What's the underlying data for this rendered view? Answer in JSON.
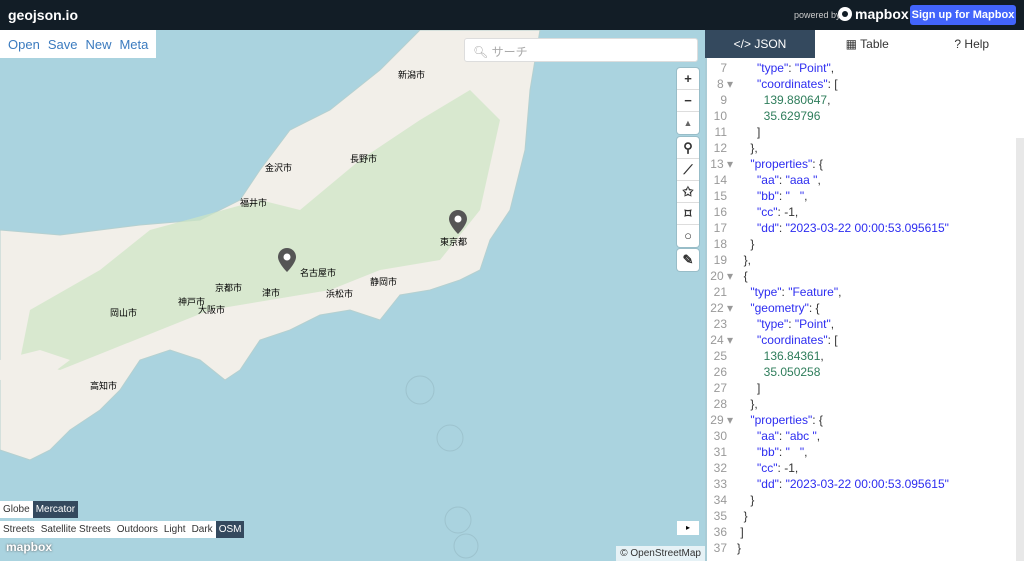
{
  "header": {
    "logo": "geojson.io",
    "powered_by": "powered by",
    "mapbox": "mapbox",
    "signup": "Sign up for Mapbox"
  },
  "file_menu": [
    "Open",
    "Save",
    "New",
    "Meta"
  ],
  "search": {
    "placeholder": "サーチ"
  },
  "map_controls": {
    "zoom_in": "+",
    "zoom_out": "−",
    "compass": "▲"
  },
  "draw_tools": [
    "marker-icon",
    "line-icon",
    "polygon-icon",
    "rectangle-icon",
    "circle-icon"
  ],
  "projection": {
    "options": [
      "Globe",
      "Mercator"
    ],
    "selected": "Mercator"
  },
  "styles": {
    "options": [
      "Streets",
      "Satellite Streets",
      "Outdoors",
      "Light",
      "Dark",
      "OSM"
    ],
    "selected": "OSM"
  },
  "map_labels": [
    "東京都",
    "名古屋市",
    "大阪市",
    "京都市",
    "浜松市",
    "静岡市",
    "長野市",
    "新潟市",
    "金沢市",
    "福井市",
    "津市",
    "神戸市",
    "岡山市",
    "高知市"
  ],
  "watermark": "mapbox",
  "attribution": "© OpenStreetMap",
  "collapse": "▸",
  "tabs": [
    {
      "label": "JSON",
      "icon": "</>"
    },
    {
      "label": "Table",
      "icon": "▦"
    },
    {
      "label": "Help",
      "icon": "?"
    }
  ],
  "editor": {
    "lines": [
      {
        "n": "7",
        "s": [
          [
            "      ",
            "p"
          ],
          [
            "\"type\"",
            "k"
          ],
          [
            ": ",
            "p"
          ],
          [
            "\"Point\"",
            "k"
          ],
          [
            ",",
            "p"
          ]
        ]
      },
      {
        "n": "8",
        "f": 1,
        "s": [
          [
            "      ",
            "p"
          ],
          [
            "\"coordinates\"",
            "k"
          ],
          [
            ": [",
            "p"
          ]
        ]
      },
      {
        "n": "9",
        "s": [
          [
            "        ",
            "p"
          ],
          [
            "139.880647",
            "n"
          ],
          [
            ",",
            "p"
          ]
        ]
      },
      {
        "n": "10",
        "s": [
          [
            "        ",
            "p"
          ],
          [
            "35.629796",
            "n"
          ]
        ]
      },
      {
        "n": "11",
        "s": [
          [
            "      ]",
            "p"
          ]
        ]
      },
      {
        "n": "12",
        "s": [
          [
            "    },",
            "p"
          ]
        ]
      },
      {
        "n": "13",
        "f": 1,
        "s": [
          [
            "    ",
            "p"
          ],
          [
            "\"properties\"",
            "k"
          ],
          [
            ": {",
            "p"
          ]
        ]
      },
      {
        "n": "14",
        "s": [
          [
            "      ",
            "p"
          ],
          [
            "\"aa\"",
            "k"
          ],
          [
            ": ",
            "p"
          ],
          [
            "\"aaa \"",
            "k"
          ],
          [
            ",",
            "p"
          ]
        ]
      },
      {
        "n": "15",
        "s": [
          [
            "      ",
            "p"
          ],
          [
            "\"bb\"",
            "k"
          ],
          [
            ": ",
            "p"
          ],
          [
            "\"   \"",
            "k"
          ],
          [
            ",",
            "p"
          ]
        ]
      },
      {
        "n": "16",
        "s": [
          [
            "      ",
            "p"
          ],
          [
            "\"cc\"",
            "k"
          ],
          [
            ": -1,",
            "p"
          ]
        ]
      },
      {
        "n": "17",
        "s": [
          [
            "      ",
            "p"
          ],
          [
            "\"dd\"",
            "k"
          ],
          [
            ": ",
            "p"
          ],
          [
            "\"2023-03-22 00:00:53.095615\"",
            "k"
          ]
        ]
      },
      {
        "n": "18",
        "s": [
          [
            "    }",
            "p"
          ]
        ]
      },
      {
        "n": "19",
        "s": [
          [
            "  },",
            "p"
          ]
        ]
      },
      {
        "n": "20",
        "f": 1,
        "s": [
          [
            "  {",
            "p"
          ]
        ]
      },
      {
        "n": "21",
        "s": [
          [
            "    ",
            "p"
          ],
          [
            "\"type\"",
            "k"
          ],
          [
            ": ",
            "p"
          ],
          [
            "\"Feature\"",
            "k"
          ],
          [
            ",",
            "p"
          ]
        ]
      },
      {
        "n": "22",
        "f": 1,
        "s": [
          [
            "    ",
            "p"
          ],
          [
            "\"geometry\"",
            "k"
          ],
          [
            ": {",
            "p"
          ]
        ]
      },
      {
        "n": "23",
        "s": [
          [
            "      ",
            "p"
          ],
          [
            "\"type\"",
            "k"
          ],
          [
            ": ",
            "p"
          ],
          [
            "\"Point\"",
            "k"
          ],
          [
            ",",
            "p"
          ]
        ]
      },
      {
        "n": "24",
        "f": 1,
        "s": [
          [
            "      ",
            "p"
          ],
          [
            "\"coordinates\"",
            "k"
          ],
          [
            ": [",
            "p"
          ]
        ]
      },
      {
        "n": "25",
        "s": [
          [
            "        ",
            "p"
          ],
          [
            "136.84361",
            "n"
          ],
          [
            ",",
            "p"
          ]
        ]
      },
      {
        "n": "26",
        "s": [
          [
            "        ",
            "p"
          ],
          [
            "35.050258",
            "n"
          ]
        ]
      },
      {
        "n": "27",
        "s": [
          [
            "      ]",
            "p"
          ]
        ]
      },
      {
        "n": "28",
        "s": [
          [
            "    },",
            "p"
          ]
        ]
      },
      {
        "n": "29",
        "f": 1,
        "s": [
          [
            "    ",
            "p"
          ],
          [
            "\"properties\"",
            "k"
          ],
          [
            ": {",
            "p"
          ]
        ]
      },
      {
        "n": "30",
        "s": [
          [
            "      ",
            "p"
          ],
          [
            "\"aa\"",
            "k"
          ],
          [
            ": ",
            "p"
          ],
          [
            "\"abc \"",
            "k"
          ],
          [
            ",",
            "p"
          ]
        ]
      },
      {
        "n": "31",
        "s": [
          [
            "      ",
            "p"
          ],
          [
            "\"bb\"",
            "k"
          ],
          [
            ": ",
            "p"
          ],
          [
            "\"   \"",
            "k"
          ],
          [
            ",",
            "p"
          ]
        ]
      },
      {
        "n": "32",
        "s": [
          [
            "      ",
            "p"
          ],
          [
            "\"cc\"",
            "k"
          ],
          [
            ": -1,",
            "p"
          ]
        ]
      },
      {
        "n": "33",
        "s": [
          [
            "      ",
            "p"
          ],
          [
            "\"dd\"",
            "k"
          ],
          [
            ": ",
            "p"
          ],
          [
            "\"2023-03-22 00:00:53.095615\"",
            "k"
          ]
        ]
      },
      {
        "n": "34",
        "s": [
          [
            "    }",
            "p"
          ]
        ]
      },
      {
        "n": "35",
        "s": [
          [
            "  }",
            "p"
          ]
        ]
      },
      {
        "n": "36",
        "s": [
          [
            " ]",
            "p"
          ]
        ]
      },
      {
        "n": "37",
        "s": [
          [
            "}",
            "p"
          ]
        ]
      }
    ]
  }
}
